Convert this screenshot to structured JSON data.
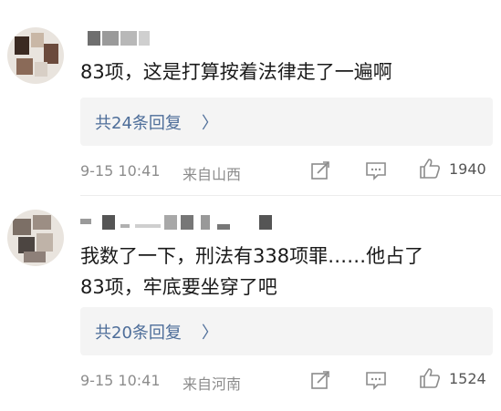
{
  "comments": [
    {
      "text": "83项，这是打算按着法律走了一遍啊",
      "reply_label": "共24条回复",
      "reply_chevron": "〉",
      "time": "9-15  10:41",
      "location": "来自山西",
      "likes": "1940",
      "icons": [
        "share-icon",
        "comment-icon",
        "thumbs-up-icon"
      ]
    },
    {
      "text_lines": [
        "我数了一下，刑法有338项罪……他占了",
        "83项，牢底要坐穿了吧"
      ],
      "reply_label": "共20条回复",
      "reply_chevron": "〉",
      "time": "9-15  10:41",
      "location": "来自河南",
      "likes": "1524",
      "icons": [
        "share-icon",
        "comment-icon",
        "thumbs-up-icon"
      ]
    }
  ],
  "colors": {
    "link": "#4d6d99",
    "meta": "#8c8c8c",
    "reply_bg": "#f4f4f4"
  }
}
